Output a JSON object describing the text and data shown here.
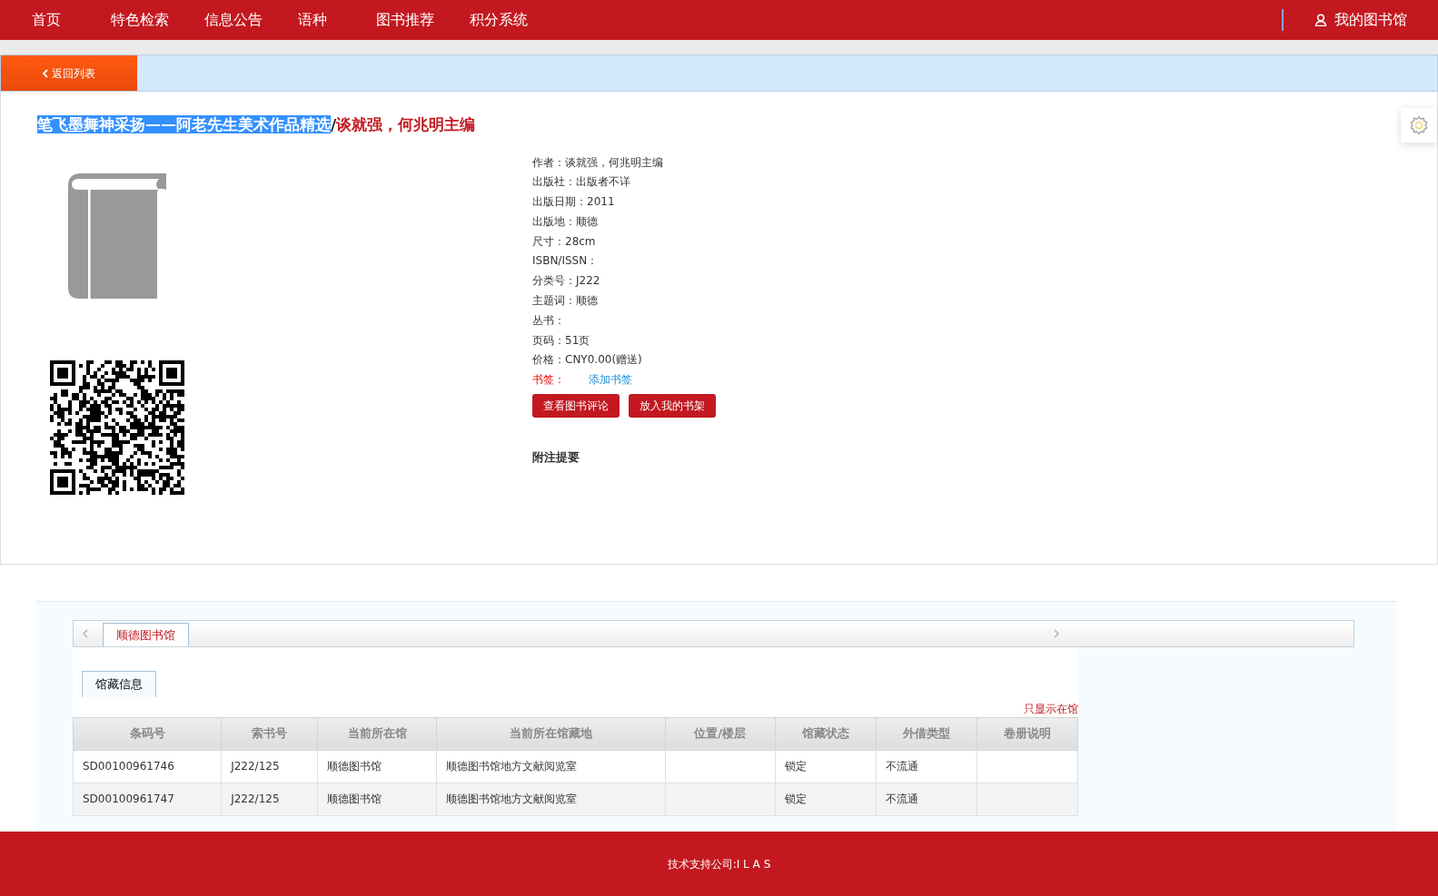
{
  "nav": {
    "items": [
      {
        "label": "首页",
        "selected": false
      },
      {
        "label": "特色检索",
        "selected": false
      },
      {
        "label": "信息公告",
        "selected": false
      },
      {
        "label": "语种",
        "selected": false
      },
      {
        "label": "图书推荐",
        "selected": false
      },
      {
        "label": "积分系统",
        "selected": false
      }
    ],
    "account": "我的图书馆"
  },
  "back_button": "返回列表",
  "title": {
    "main": "笔飞墨舞神采扬——阿老先生美术作品精选",
    "selected": true,
    "separator": "/",
    "responsibility": "谈就强，何兆明主编"
  },
  "details": [
    {
      "label": "作者：",
      "value": "谈就强，何兆明主编",
      "kind": "text"
    },
    {
      "label": "出版社：",
      "value": "出版者不详",
      "kind": "text"
    },
    {
      "label": "出版日期：",
      "value": "2011",
      "kind": "text"
    },
    {
      "label": "出版地：",
      "value": "顺德",
      "kind": "text"
    },
    {
      "label": "尺寸：",
      "value": "28cm",
      "kind": "text"
    },
    {
      "label": "ISBN/ISSN：",
      "kind": "text"
    },
    {
      "label": "分类号：",
      "value": "J222",
      "kind": "text"
    },
    {
      "label": "主题词：",
      "value": "顺德",
      "kind": "text"
    },
    {
      "label": "丛书：",
      "kind": "text"
    },
    {
      "label": "页码：",
      "value": "51页",
      "kind": "text"
    },
    {
      "label": "价格：",
      "value": "CNY0.00(赠送)",
      "kind": "text"
    },
    {
      "label": "书签：",
      "value": "添加书签",
      "kind": "link"
    }
  ],
  "actions": [
    "查看图书评论",
    "放入我的书架"
  ],
  "notes_heading": "附注提要",
  "library_tabs": [
    {
      "label": "顺德图书馆",
      "selected": true
    }
  ],
  "holdings_tabs": [
    {
      "label": "馆藏信息",
      "selected": true
    }
  ],
  "filter_link": "只显示在馆",
  "table": {
    "columns": [
      "条码号",
      "索书号",
      "当前所在馆",
      "当前所在馆藏地",
      "位置/楼层",
      "馆藏状态",
      "外借类型",
      "卷册说明"
    ],
    "rows": [
      [
        "SD00100961746",
        "J222/125",
        "顺德图书馆",
        "顺德图书馆地方文献阅览室",
        "",
        "锁定",
        "不流通",
        ""
      ],
      [
        "SD00100961747",
        "J222/125",
        "顺德图书馆",
        "顺德图书馆地方文献阅览室",
        "",
        "锁定",
        "不流通",
        ""
      ]
    ]
  },
  "footer": {
    "label": "技术支持公司:",
    "company": "I L A S"
  }
}
